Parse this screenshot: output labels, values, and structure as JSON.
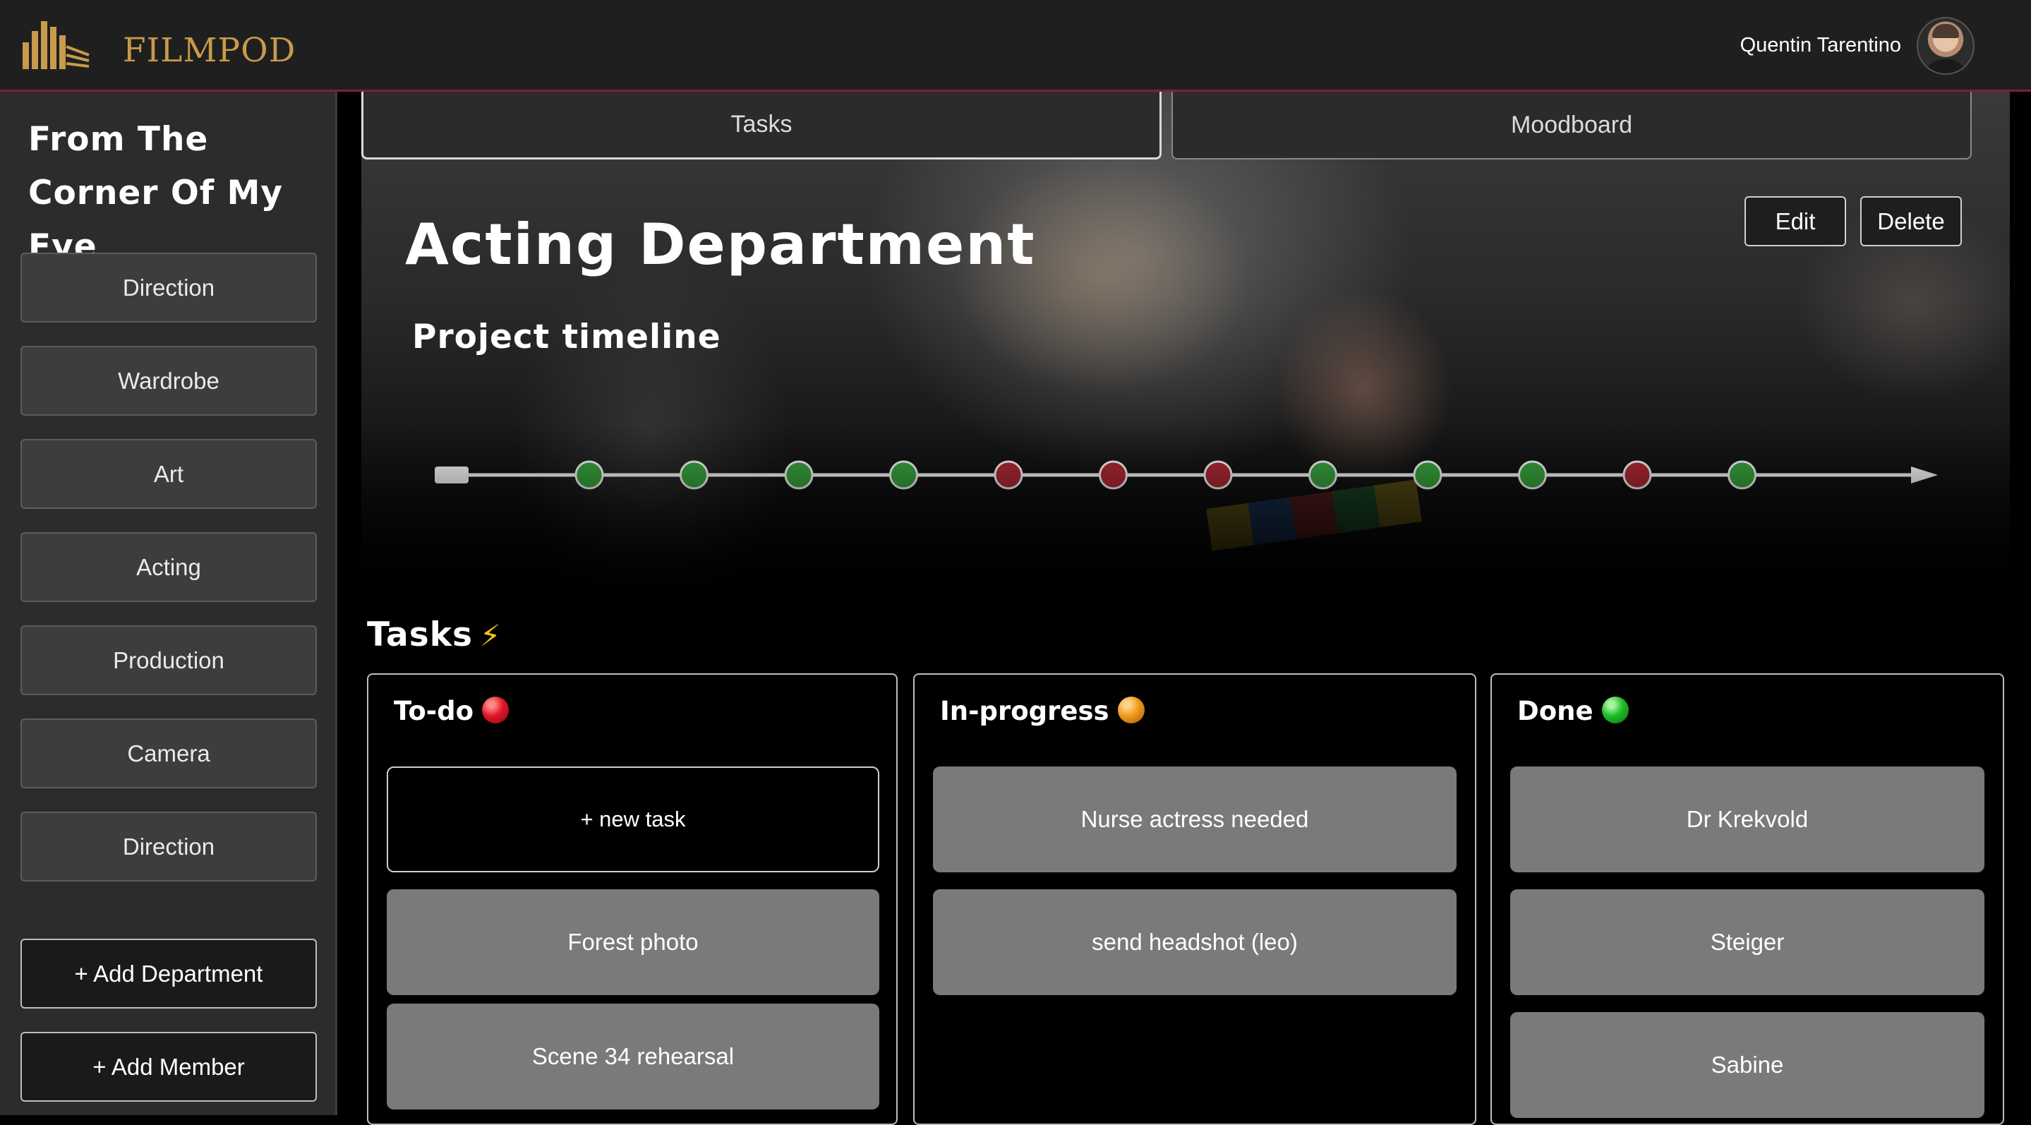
{
  "header": {
    "brand": "FILMPOD",
    "user_name": "Quentin Tarentino"
  },
  "sidebar": {
    "project_title": "From The Corner Of My Eye",
    "departments": [
      "Direction",
      "Wardrobe",
      "Art",
      "Acting",
      "Production",
      "Camera",
      "Direction"
    ],
    "add_department_label": "+ Add Department",
    "add_member_label": "+ Add Member"
  },
  "tabs": [
    {
      "label": "Tasks",
      "active": true
    },
    {
      "label": "Moodboard",
      "active": false
    }
  ],
  "department": {
    "title": "Acting Department",
    "edit_label": "Edit",
    "delete_label": "Delete"
  },
  "timeline": {
    "title": "Project timeline",
    "milestones": [
      "green",
      "green",
      "green",
      "green",
      "red",
      "red",
      "red",
      "green",
      "green",
      "green",
      "red",
      "green"
    ]
  },
  "tasks": {
    "heading": "Tasks",
    "heading_icon": "⚡",
    "columns": [
      {
        "title": "To-do",
        "status_color": "red",
        "new_task_label": "+ new task",
        "cards": [
          "Forest photo",
          "Scene 34 rehearsal"
        ]
      },
      {
        "title": "In-progress",
        "status_color": "orange",
        "cards": [
          "Nurse actress needed",
          "send headshot (leo)"
        ]
      },
      {
        "title": "Done",
        "status_color": "green",
        "cards": [
          "Dr Krekvold",
          "Steiger",
          "Sabine"
        ]
      }
    ]
  },
  "colors": {
    "brand_gold": "#c89a4b",
    "milestone_green": "#3aa83f",
    "milestone_red": "#b52a35",
    "header_accent": "#7a2332"
  }
}
